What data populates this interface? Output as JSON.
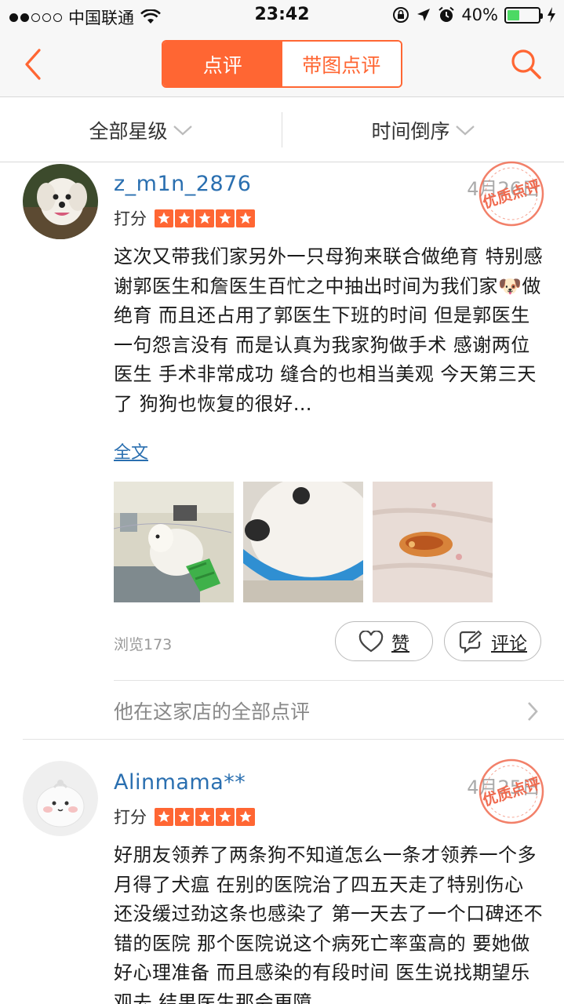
{
  "status_bar": {
    "carrier": "中国联通",
    "time": "23:42",
    "battery": "40%",
    "battery_level": 0.4
  },
  "nav": {
    "tabs": [
      {
        "label": "点评",
        "active": true
      },
      {
        "label": "带图点评",
        "active": false
      }
    ]
  },
  "filters": {
    "star_filter": "全部星级",
    "sort_filter": "时间倒序"
  },
  "colors": {
    "accent": "#ff6633",
    "link": "#2a6fb0"
  },
  "reviews": [
    {
      "username": "z_m1n_2876",
      "date": "4月26日",
      "score_label": "打分",
      "stars": 5,
      "badge": "优质点评",
      "content": "这次又带我们家另外一只母狗来联合做绝育 特别感谢郭医生和詹医生百忙之中抽出时间为我们家🐶做绝育 而且还占用了郭医生下班的时间 但是郭医生一句怨言没有 而是认真为我家狗做手术 感谢两位医生 手术非常成功 缝合的也相当美观 今天第三天了 狗狗也恢复的很好…",
      "more": "全文",
      "views": "浏览173",
      "like_label": "赞",
      "comment_label": "评论",
      "shop_reviews_link": "他在这家店的全部点评"
    },
    {
      "username": "Alinmama**",
      "date": "4月25日",
      "score_label": "打分",
      "stars": 5,
      "badge": "优质点评",
      "content": "好朋友领养了两条狗不知道怎么一条才领养一个多月得了犬瘟 在别的医院治了四五天走了特别伤心 还没缓过劲这条也感染了 第一天去了一个口碑还不错的医院 那个医院说这个病死亡率蛮高的 要她做好心理准备 而且感染的有段时间 医生说找期望乐观去 结果医生那会更障"
    }
  ]
}
